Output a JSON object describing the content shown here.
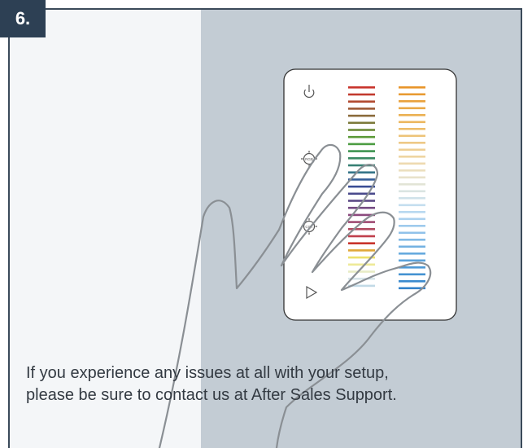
{
  "step": {
    "label": "6."
  },
  "controller": {
    "buttons": [
      {
        "name": "power",
        "icon": "power-icon",
        "label": ""
      },
      {
        "name": "rgb",
        "icon": "rgb-brightness-icon",
        "label": "RGB"
      },
      {
        "name": "cct",
        "icon": "cct-brightness-icon",
        "label": "CCT"
      },
      {
        "name": "play",
        "icon": "play-icon",
        "label": ""
      }
    ],
    "rgb_colors": [
      "#c8342c",
      "#c23a2e",
      "#b24a30",
      "#9c5a36",
      "#8a6a3a",
      "#7c7a3a",
      "#6c8a38",
      "#5c9a38",
      "#4c9c42",
      "#3e9450",
      "#3a8a62",
      "#368074",
      "#347488",
      "#365e98",
      "#3a4e94",
      "#4a4a8c",
      "#5c4a86",
      "#744a82",
      "#8c4a7e",
      "#9e4a72",
      "#b04a60",
      "#c0404c",
      "#c8342c",
      "#e0a838",
      "#ece06a",
      "#eeea98",
      "#e8ecc6",
      "#d6e4e8",
      "#c2dae6"
    ],
    "cct_colors": [
      "#e8952a",
      "#e89b32",
      "#e9a23c",
      "#eaa946",
      "#ebb052",
      "#ecb75e",
      "#edbd6a",
      "#edc378",
      "#eec986",
      "#eecf94",
      "#eed5a2",
      "#eedab0",
      "#ecdfbe",
      "#e8e2ca",
      "#e2e4d6",
      "#dae4e2",
      "#d0e2ea",
      "#c4deef",
      "#b8d8f0",
      "#abd1ef",
      "#9ecaed",
      "#90c2ea",
      "#82bae6",
      "#74b2e2",
      "#66aade",
      "#5aa2da",
      "#4e9ad6",
      "#4492d2",
      "#3a8ace",
      "#3282ca"
    ]
  },
  "instruction": {
    "line1": "If you experience any issues at all with your setup,",
    "line2": "please be sure to contact us at After Sales Support."
  }
}
